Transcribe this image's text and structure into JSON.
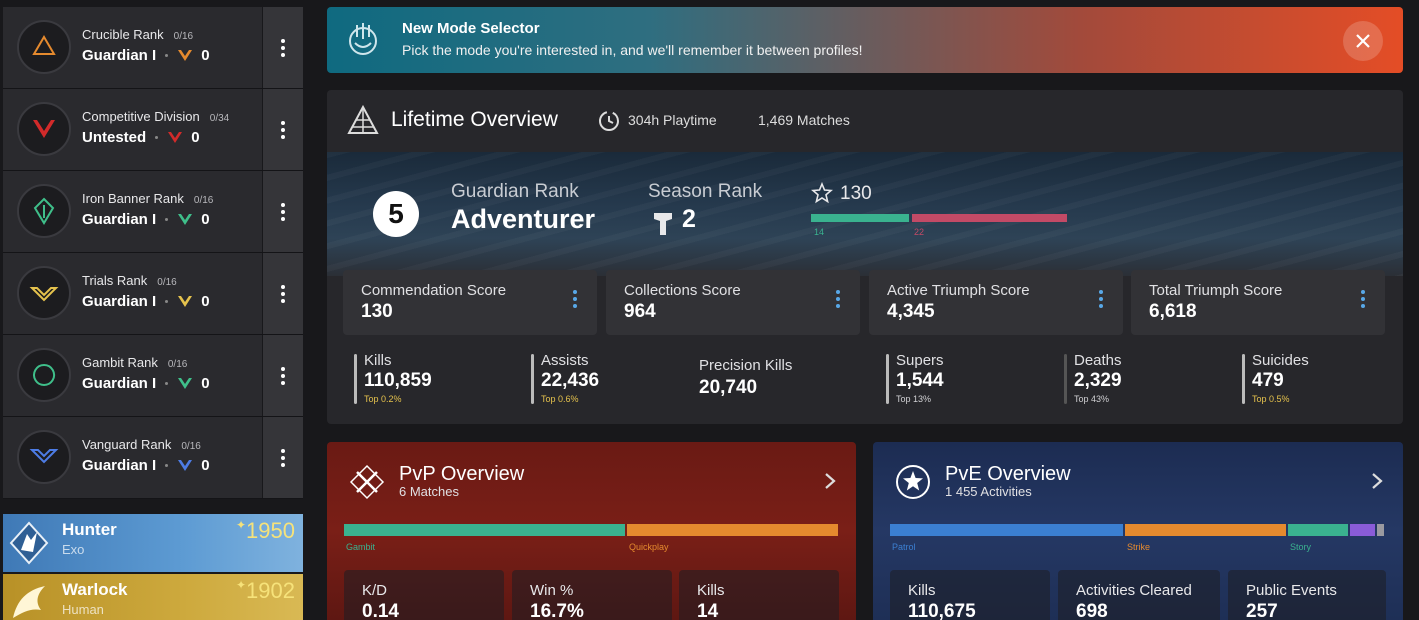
{
  "ranks": [
    {
      "name": "Crucible Rank",
      "progress": "0/16",
      "tier": "Guardian I",
      "value": "0",
      "color": "#e58a2e",
      "icon": "crucible-emblem-icon"
    },
    {
      "name": "Competitive Division",
      "progress": "0/34",
      "tier": "Untested",
      "value": "0",
      "color": "#d22a2a",
      "icon": "competitive-emblem-icon"
    },
    {
      "name": "Iron Banner Rank",
      "progress": "0/16",
      "tier": "Guardian I",
      "value": "0",
      "color": "#3fbf8a",
      "icon": "iron-banner-emblem-icon"
    },
    {
      "name": "Trials Rank",
      "progress": "0/16",
      "tier": "Guardian I",
      "value": "0",
      "color": "#e5c24d",
      "icon": "trials-emblem-icon"
    },
    {
      "name": "Gambit Rank",
      "progress": "0/16",
      "tier": "Guardian I",
      "value": "0",
      "color": "#3fbf8a",
      "icon": "gambit-emblem-icon"
    },
    {
      "name": "Vanguard Rank",
      "progress": "0/16",
      "tier": "Guardian I",
      "value": "0",
      "color": "#4d7ce5",
      "icon": "vanguard-emblem-icon"
    }
  ],
  "characters": [
    {
      "class": "Hunter",
      "race": "Exo",
      "light": "1950",
      "icon": "hunter-emblem-icon"
    },
    {
      "class": "Warlock",
      "race": "Human",
      "light": "1902",
      "icon": "warlock-emblem-icon"
    }
  ],
  "banner": {
    "title": "New Mode Selector",
    "text": "Pick the mode you're interested in, and we'll remember it between profiles!",
    "icon": "mode-selector-icon"
  },
  "lifetime": {
    "title": "Lifetime Overview",
    "playtime": "304h Playtime",
    "matches": "1,469 Matches",
    "guardian_rank_number": "5",
    "guardian_rank_label": "Guardian Rank",
    "guardian_rank_value": "Adventurer",
    "season_rank_label": "Season Rank",
    "season_rank_value": "2",
    "season_star_value": "130",
    "season_bar": {
      "left_value": "14",
      "right_value": "22",
      "left_fraction": 0.39,
      "left_color": "#3ab28f",
      "right_color": "#c34a66"
    },
    "scores": [
      {
        "label": "Commendation Score",
        "value": "130"
      },
      {
        "label": "Collections Score",
        "value": "964"
      },
      {
        "label": "Active Triumph Score",
        "value": "4,345"
      },
      {
        "label": "Total Triumph Score",
        "value": "6,618"
      }
    ],
    "stats": [
      {
        "label": "Kills",
        "value": "110,859",
        "top": "Top 0.2%",
        "top_color": "gold"
      },
      {
        "label": "Assists",
        "value": "22,436",
        "top": "Top 0.6%",
        "top_color": "gold"
      },
      {
        "label": "Precision Kills",
        "value": "20,740",
        "top": ""
      },
      {
        "label": "Supers",
        "value": "1,544",
        "top": "Top 13%",
        "top_color": "gray"
      },
      {
        "label": "Deaths",
        "value": "2,329",
        "top": "Top 43%",
        "top_color": "gray"
      },
      {
        "label": "Suicides",
        "value": "479",
        "top": "Top 0.5%",
        "top_color": "gold"
      }
    ]
  },
  "pvp": {
    "title": "PvP Overview",
    "subtitle": "6 Matches",
    "modes": [
      {
        "label": "Gambit",
        "fraction": 0.57,
        "color": "#3ab28f"
      },
      {
        "label": "Quickplay",
        "fraction": 0.43,
        "color": "#e58a2e"
      }
    ],
    "cards": [
      {
        "label": "K/D",
        "value": "0.14"
      },
      {
        "label": "Win %",
        "value": "16.7%"
      },
      {
        "label": "Kills",
        "value": "14"
      }
    ]
  },
  "pve": {
    "title": "PvE Overview",
    "subtitle": "1 455 Activities",
    "modes": [
      {
        "label": "Patrol",
        "fraction": 0.474,
        "color": "#3b7fd1"
      },
      {
        "label": "Strike",
        "fraction": 0.329,
        "color": "#e58a2e"
      },
      {
        "label": "Story",
        "fraction": 0.125,
        "color": "#3ab28f"
      },
      {
        "label": "",
        "fraction": 0.054,
        "color": "#8a5cd8"
      },
      {
        "label": "",
        "fraction": 0.018,
        "color": "#9a9aa0"
      }
    ],
    "cards": [
      {
        "label": "Kills",
        "value": "110,675"
      },
      {
        "label": "Activities Cleared",
        "value": "698"
      },
      {
        "label": "Public Events",
        "value": "257"
      }
    ]
  }
}
